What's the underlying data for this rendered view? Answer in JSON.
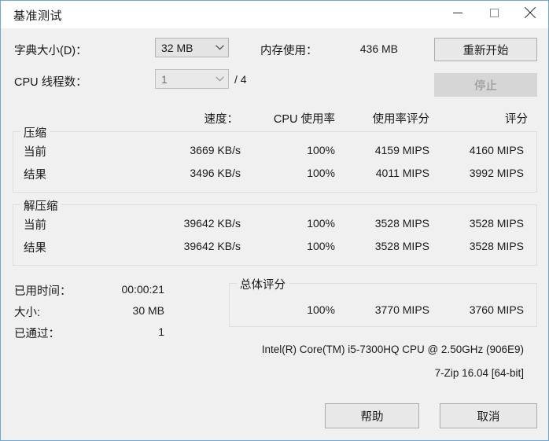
{
  "window": {
    "title": "基准测试",
    "controls": {
      "minimize": "minimize-icon",
      "maximize": "maximize-icon",
      "close": "close-icon"
    }
  },
  "settings": {
    "dictionary_label": "字典大小(D)：",
    "dictionary_value": "32 MB",
    "threads_label": "CPU 线程数：",
    "threads_value": "1",
    "threads_total": "/ 4",
    "memory_label": "内存使用：",
    "memory_value": "436 MB"
  },
  "actions": {
    "restart": "重新开始",
    "stop": "停止",
    "help": "帮助",
    "cancel": "取消"
  },
  "columns": {
    "speed": "速度：",
    "cpu_usage": "CPU 使用率",
    "usage_rating": "使用率评分",
    "rating": "评分"
  },
  "compress": {
    "title": "压缩",
    "rows": [
      {
        "label": "当前",
        "speed": "3669 KB/s",
        "cpu_usage": "100%",
        "usage_rating": "4159 MIPS",
        "rating": "4160 MIPS"
      },
      {
        "label": "结果",
        "speed": "3496 KB/s",
        "cpu_usage": "100%",
        "usage_rating": "4011 MIPS",
        "rating": "3992 MIPS"
      }
    ]
  },
  "decompress": {
    "title": "解压缩",
    "rows": [
      {
        "label": "当前",
        "speed": "39642 KB/s",
        "cpu_usage": "100%",
        "usage_rating": "3528 MIPS",
        "rating": "3528 MIPS"
      },
      {
        "label": "结果",
        "speed": "39642 KB/s",
        "cpu_usage": "100%",
        "usage_rating": "3528 MIPS",
        "rating": "3528 MIPS"
      }
    ]
  },
  "stats": {
    "elapsed_label": "已用时间：",
    "elapsed_value": "00:00:21",
    "size_label": "大小:",
    "size_value": "30 MB",
    "passes_label": "已通过：",
    "passes_value": "1"
  },
  "total": {
    "title": "总体评分",
    "cpu_usage": "100%",
    "usage_rating": "3770 MIPS",
    "rating": "3760 MIPS"
  },
  "footer": {
    "cpu_info": "Intel(R) Core(TM) i5-7300HQ CPU @ 2.50GHz (906E9)",
    "version": "7-Zip 16.04 [64-bit]"
  },
  "colors": {
    "window_border": "#6ca9d4",
    "body_bg": "#f0f0f0",
    "titlebar_bg": "#ffffff",
    "group_border": "#dedede",
    "button_bg": "#e8e8e8",
    "disabled_bg": "#d6d6d6"
  }
}
